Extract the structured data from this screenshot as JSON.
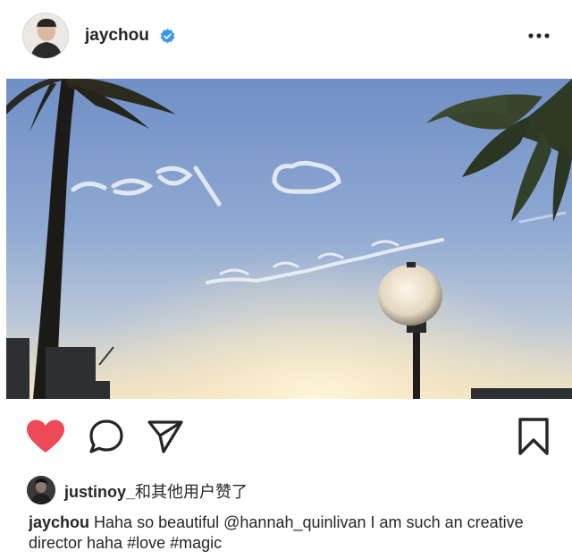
{
  "post": {
    "username": "jaychou",
    "verified_icon": "verified-badge-icon",
    "more_icon": "more-options-icon",
    "photo": {
      "description_icon": "post-photo",
      "skywriting_line1": "I love",
      "skywriting_line2": "Surrender"
    },
    "actions": {
      "like_icon": "heart-filled-icon",
      "like_color": "#ed4956",
      "comment_icon": "comment-icon",
      "share_icon": "send-icon",
      "save_icon": "bookmark-icon"
    },
    "likes": {
      "first_user": "justinoy_",
      "rest_text": "和其他用户赞了"
    },
    "caption": {
      "user": "jaychou",
      "text_before": " Haha so beautiful ",
      "mention": "@hannah_quinlivan",
      "text_after": " I am such an creative director haha ",
      "tag1": "#love",
      "space": " ",
      "tag2": "#magic"
    }
  }
}
